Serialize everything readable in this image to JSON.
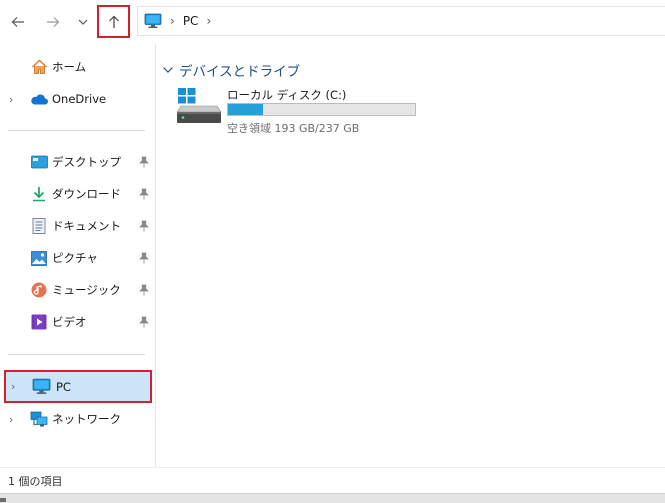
{
  "toolbar": {
    "back_icon": "arrow-left-icon",
    "forward_icon": "arrow-right-icon",
    "recent_icon": "chevron-down-icon",
    "up_icon": "arrow-up-icon"
  },
  "address": {
    "segments": [
      "PC"
    ],
    "icon": "pc-monitor-icon"
  },
  "sidebar": {
    "items": [
      {
        "label": "ホーム",
        "icon": "home-icon",
        "expandable": false,
        "pinned": false
      },
      {
        "label": "OneDrive",
        "icon": "cloud-icon",
        "expandable": true,
        "pinned": false
      },
      {
        "label": "デスクトップ",
        "icon": "desktop-icon",
        "expandable": false,
        "pinned": true
      },
      {
        "label": "ダウンロード",
        "icon": "download-icon",
        "expandable": false,
        "pinned": true
      },
      {
        "label": "ドキュメント",
        "icon": "document-icon",
        "expandable": false,
        "pinned": true
      },
      {
        "label": "ピクチャ",
        "icon": "pictures-icon",
        "expandable": false,
        "pinned": true
      },
      {
        "label": "ミュージック",
        "icon": "music-icon",
        "expandable": false,
        "pinned": true
      },
      {
        "label": "ビデオ",
        "icon": "video-icon",
        "expandable": false,
        "pinned": true
      },
      {
        "label": "PC",
        "icon": "pc-monitor-icon",
        "expandable": true,
        "selected": true
      },
      {
        "label": "ネットワーク",
        "icon": "network-icon",
        "expandable": true
      }
    ]
  },
  "main": {
    "group_title": "デバイスとドライブ",
    "drives": [
      {
        "name": "ローカル ディスク (C:)",
        "space_text": "空き領域 193 GB/237 GB",
        "used_fraction": 0.186,
        "icon": "windows-drive-icon"
      }
    ]
  },
  "status": {
    "item_count": "1 個の項目"
  },
  "colors": {
    "accent": "#26a0da",
    "selection": "#cce4f7",
    "highlight_box": "#d61f2c",
    "group_header": "#1e4e8c"
  }
}
